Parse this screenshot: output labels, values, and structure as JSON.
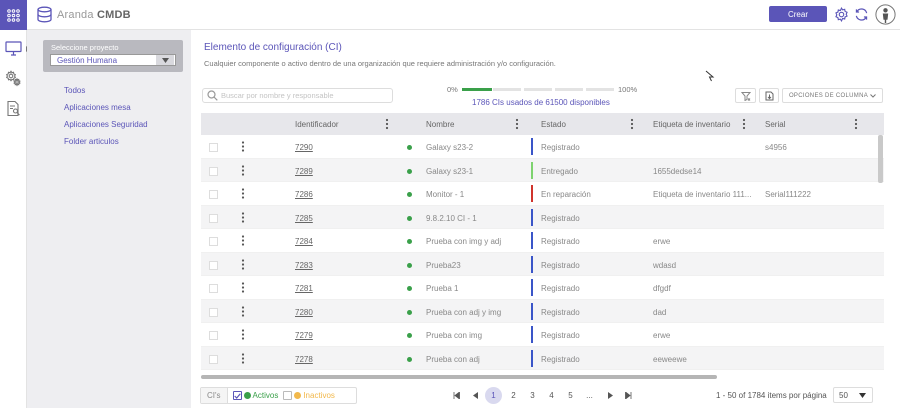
{
  "header": {
    "brand_light": "Aranda",
    "brand_bold": "CMDB",
    "create_label": "Crear"
  },
  "sidebar": {
    "project_label": "Seleccione proyecto",
    "project_value": "Gestión Humana",
    "links": [
      "Todos",
      "Aplicaciones mesa",
      "Aplicaciones Seguridad",
      "Folder articulos"
    ]
  },
  "main": {
    "title": "Elemento de configuración (CI)",
    "subtitle": "Cualquier componente o activo dentro de una organización que requiere administración y/o configuración.",
    "search_placeholder": "Buscar por nombre y responsable",
    "usage": {
      "min_label": "0%",
      "max_label": "100%",
      "text": "1786 CIs usados de 61500 disponibles",
      "fraction": 0.029
    },
    "column_options_label": "OPCIONES DE COLUMNA"
  },
  "table": {
    "columns": [
      "Identificador",
      "Nombre",
      "Estado",
      "Etiqueta de inventario",
      "Serial"
    ],
    "rows": [
      {
        "id": "7290",
        "name": "Galaxy s23-2",
        "state": "Registrado",
        "state_color": "#3a55c8",
        "tag": "",
        "serial": "s4956"
      },
      {
        "id": "7289",
        "name": "Galaxy s23-1",
        "state": "Entregado",
        "state_color": "#7ed36f",
        "tag": "1655dedse14",
        "serial": ""
      },
      {
        "id": "7286",
        "name": "Monitor - 1",
        "state": "En reparación",
        "state_color": "#d0342c",
        "tag": "Etiqueta de inventario 111...",
        "serial": "Serial111222"
      },
      {
        "id": "7285",
        "name": "9.8.2.10 CI - 1",
        "state": "Registrado",
        "state_color": "#3a55c8",
        "tag": "",
        "serial": ""
      },
      {
        "id": "7284",
        "name": "Prueba con img y adj",
        "state": "Registrado",
        "state_color": "#3a55c8",
        "tag": "erwe",
        "serial": ""
      },
      {
        "id": "7283",
        "name": "Prueba23",
        "state": "Registrado",
        "state_color": "#3a55c8",
        "tag": "wdasd",
        "serial": ""
      },
      {
        "id": "7281",
        "name": "Prueba 1",
        "state": "Registrado",
        "state_color": "#3a55c8",
        "tag": "dfgdf",
        "serial": ""
      },
      {
        "id": "7280",
        "name": "Prueba con adj y img",
        "state": "Registrado",
        "state_color": "#3a55c8",
        "tag": "dad",
        "serial": ""
      },
      {
        "id": "7279",
        "name": "Prueba con img",
        "state": "Registrado",
        "state_color": "#3a55c8",
        "tag": "erwe",
        "serial": ""
      },
      {
        "id": "7278",
        "name": "Prueba con adj",
        "state": "Registrado",
        "state_color": "#3a55c8",
        "tag": "eeweewe",
        "serial": ""
      }
    ]
  },
  "footer": {
    "legend_label": "CI's",
    "active_label": "Activos",
    "inactive_label": "Inactivos",
    "active_color": "#3aa04a",
    "inactive_color": "#f2b84b",
    "pages": [
      "1",
      "2",
      "3",
      "4",
      "5",
      "..."
    ],
    "current_page": "1",
    "items_text": "1 - 50 of 1784 items por página",
    "page_size": "50"
  },
  "colors": {
    "accent": "#5b55b8",
    "active_green": "#3aa04a"
  }
}
